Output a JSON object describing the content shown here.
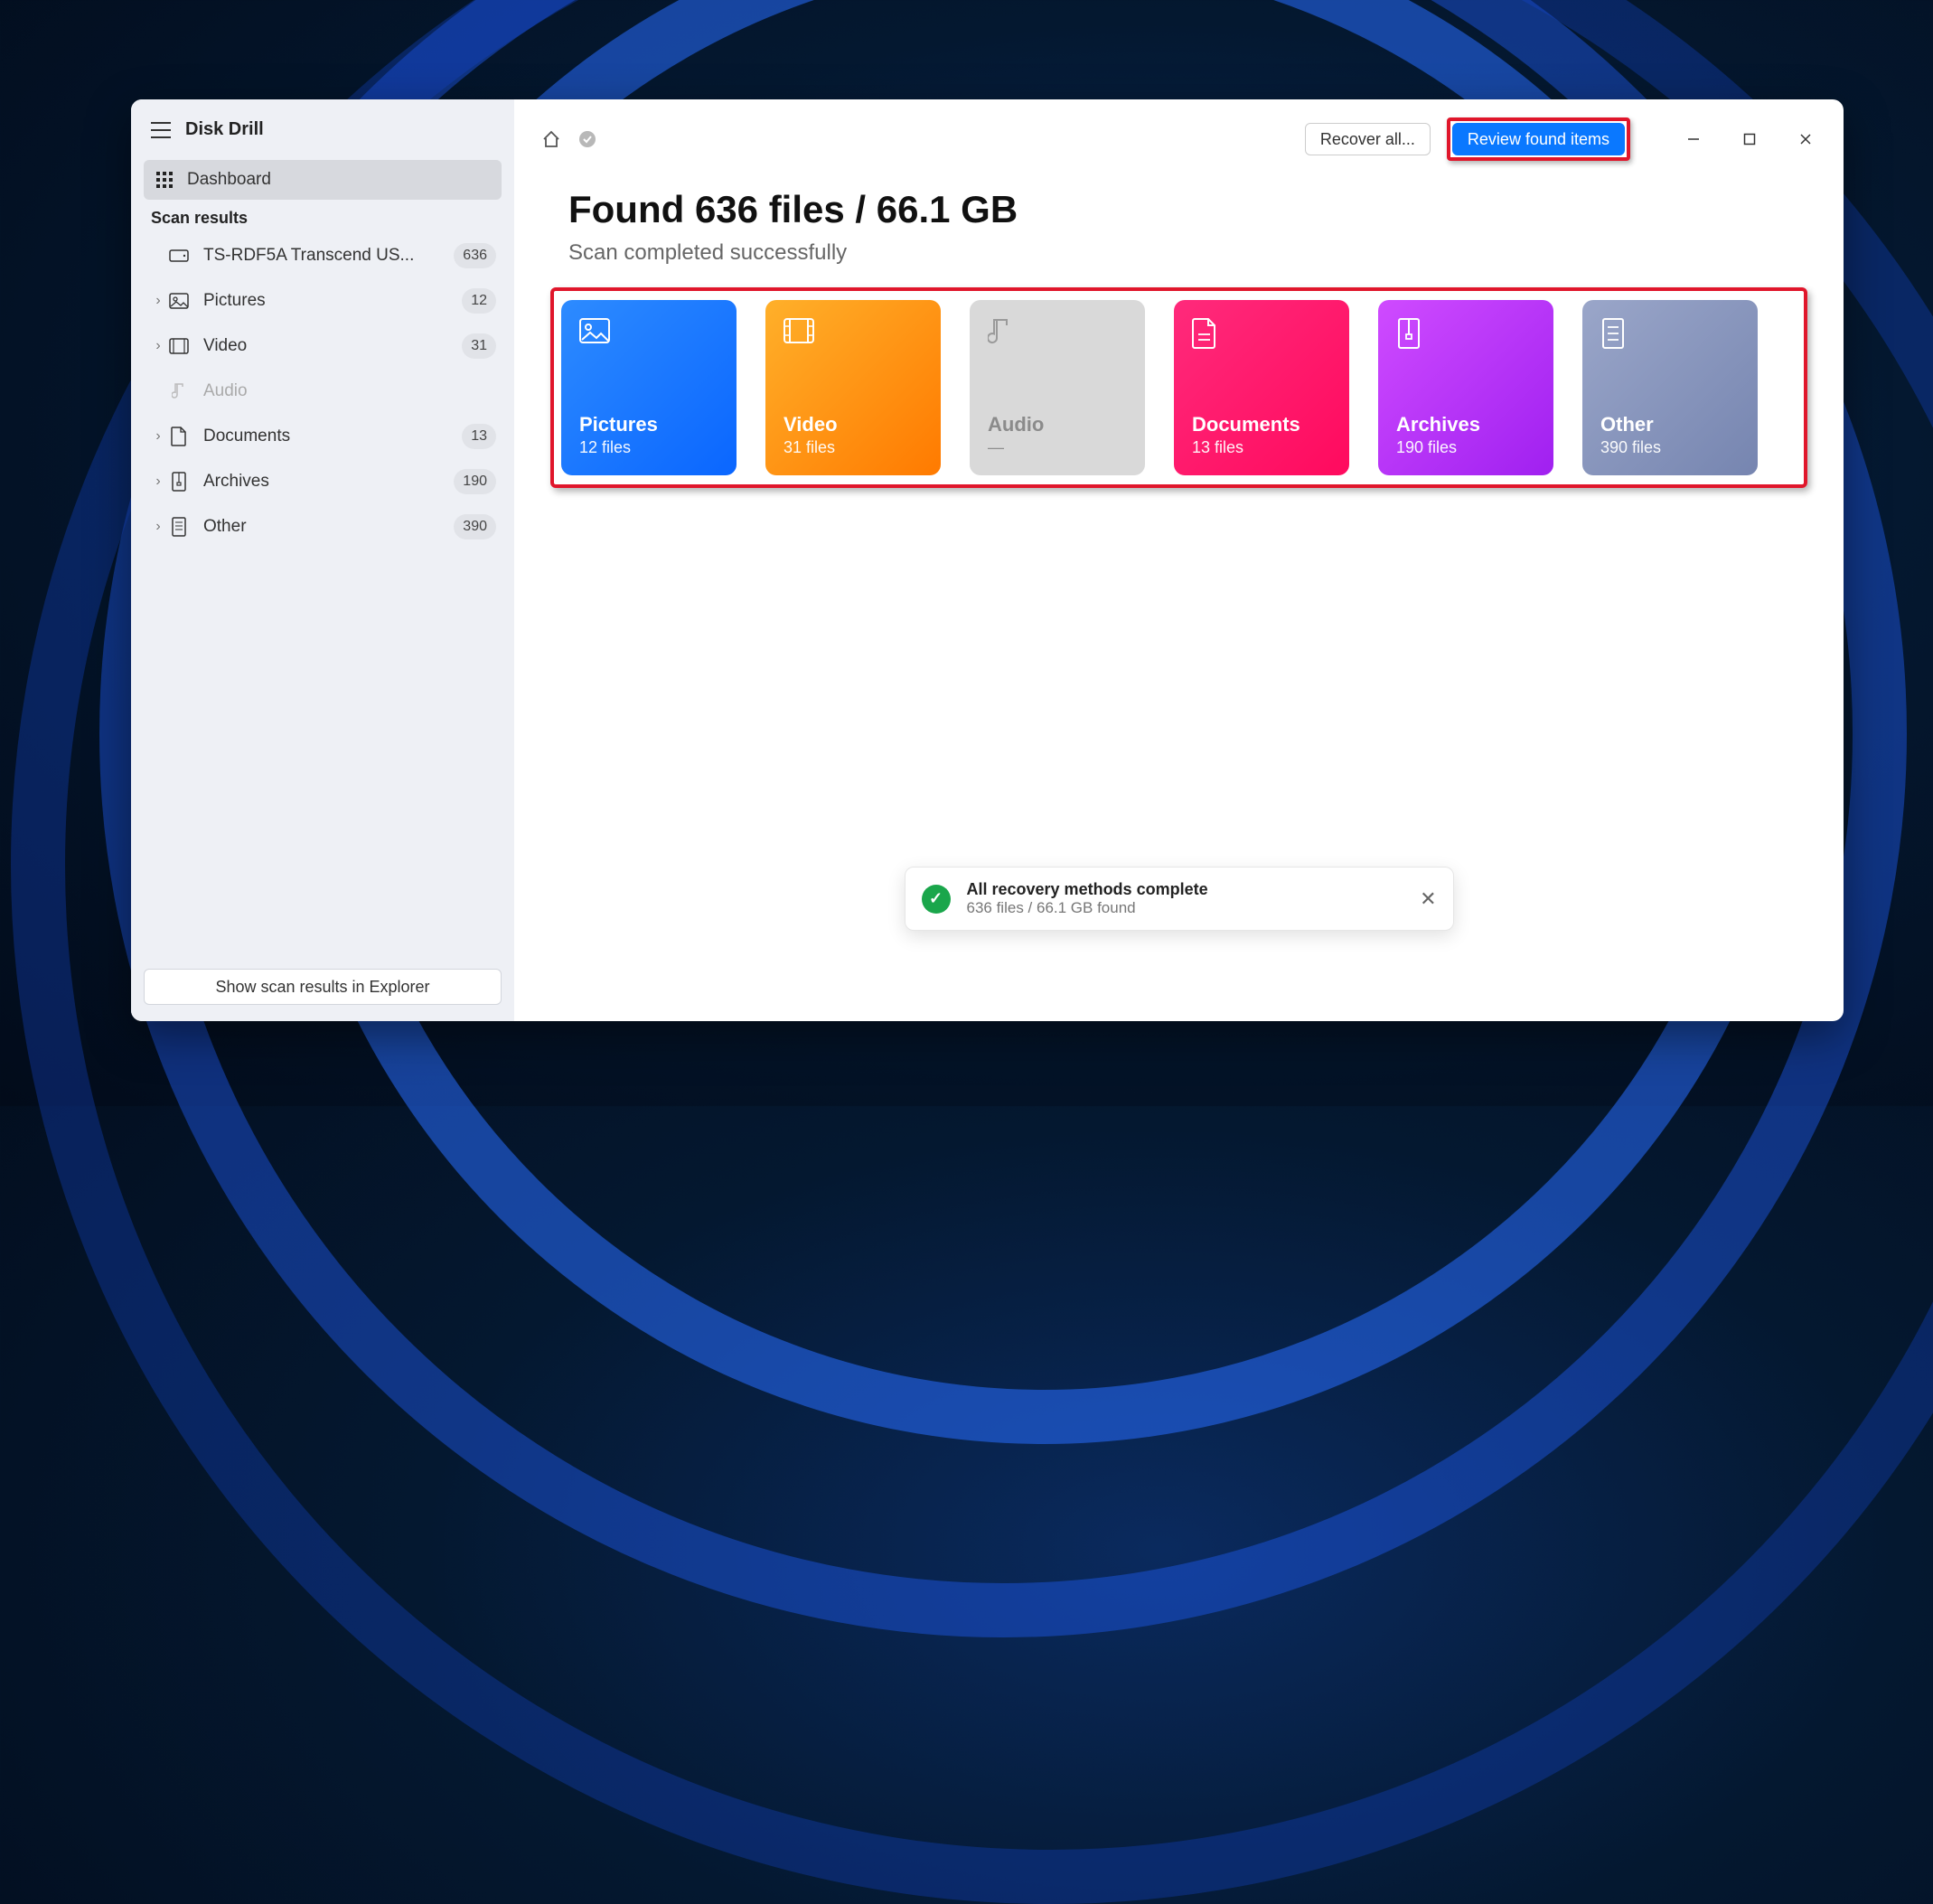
{
  "app_title": "Disk Drill",
  "sidebar": {
    "dashboard_label": "Dashboard",
    "section_label": "Scan results",
    "device_label": "TS-RDF5A Transcend US...",
    "device_count": "636",
    "items": [
      {
        "label": "Pictures",
        "count": "12",
        "expandable": true
      },
      {
        "label": "Video",
        "count": "31",
        "expandable": true
      },
      {
        "label": "Audio",
        "count": "",
        "expandable": false,
        "disabled": true
      },
      {
        "label": "Documents",
        "count": "13",
        "expandable": true
      },
      {
        "label": "Archives",
        "count": "190",
        "expandable": true
      },
      {
        "label": "Other",
        "count": "390",
        "expandable": true
      }
    ],
    "footer_button": "Show scan results in Explorer"
  },
  "toolbar": {
    "recover_label": "Recover all...",
    "review_label": "Review found items"
  },
  "heading": {
    "title": "Found 636 files / 66.1 GB",
    "subtitle": "Scan completed successfully"
  },
  "cards": {
    "pictures": {
      "title": "Pictures",
      "sub": "12 files"
    },
    "video": {
      "title": "Video",
      "sub": "31 files"
    },
    "audio": {
      "title": "Audio",
      "sub": "—"
    },
    "documents": {
      "title": "Documents",
      "sub": "13 files"
    },
    "archives": {
      "title": "Archives",
      "sub": "190 files"
    },
    "other": {
      "title": "Other",
      "sub": "390 files"
    }
  },
  "toast": {
    "title": "All recovery methods complete",
    "subtitle": "636 files / 66.1 GB found"
  }
}
